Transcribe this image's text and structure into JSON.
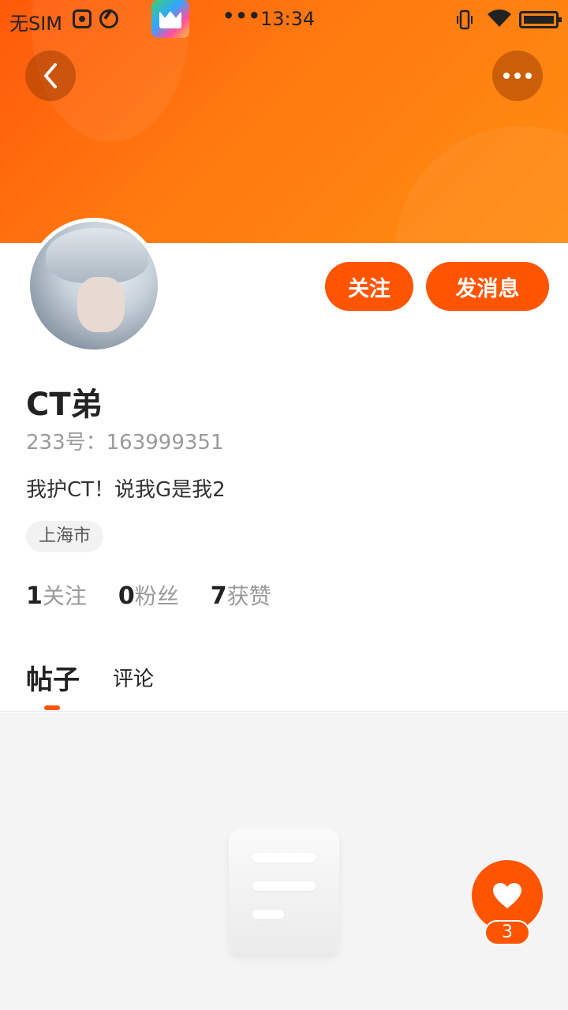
{
  "status_bar": {
    "carrier": "无SIM",
    "dots": "•••",
    "time": "13:34"
  },
  "actions": {
    "follow_label": "关注",
    "message_label": "发消息"
  },
  "profile": {
    "username": "CT弟",
    "id_label": "233号：",
    "id_value": "163999351",
    "bio": "我护CT！说我G是我2",
    "location": "上海市"
  },
  "stats": [
    {
      "count": "1",
      "label": "关注"
    },
    {
      "count": "0",
      "label": "粉丝"
    },
    {
      "count": "7",
      "label": "获赞"
    }
  ],
  "tabs": {
    "posts": "帖子",
    "comments": "评论"
  },
  "like_fab": {
    "count": "3"
  },
  "colors": {
    "accent": "#ff5400",
    "header_gradient_start": "#ff5a0a",
    "header_gradient_end": "#ff8d12"
  }
}
